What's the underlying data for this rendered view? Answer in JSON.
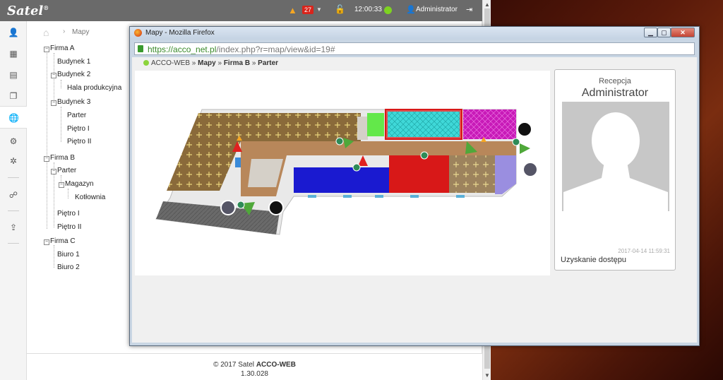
{
  "app": {
    "logo": "Satel",
    "logo_mark": "®"
  },
  "topbar": {
    "alarm_count": "27",
    "time": "12:00:33",
    "user": "Administrator"
  },
  "sidebar_icons": [
    "user-icon",
    "calendar-icon",
    "document-icon",
    "documents-icon",
    "globe-icon",
    "gears-icon",
    "gear-icon",
    "users-icon",
    "upload-icon"
  ],
  "breadcrumb": {
    "label": "Mapy"
  },
  "tree": [
    {
      "label": "Firma A",
      "toggle": "⊟"
    },
    {
      "label": "Budynek 1"
    },
    {
      "label": "Budynek 2",
      "toggle": "⊟"
    },
    {
      "label": "Hala produkcyjna"
    },
    {
      "label": "Budynek 3",
      "toggle": "⊟"
    },
    {
      "label": "Parter"
    },
    {
      "label": "Piętro I"
    },
    {
      "label": "Piętro II"
    },
    {
      "label": "Firma B",
      "toggle": "⊟"
    },
    {
      "label": "Parter",
      "toggle": "⊟"
    },
    {
      "label": "Magazyn",
      "toggle": "⊟"
    },
    {
      "label": "Kotłownia"
    },
    {
      "label": "Piętro I"
    },
    {
      "label": "Piętro II"
    },
    {
      "label": "Firma C",
      "toggle": "⊟"
    },
    {
      "label": "Biuro 1"
    },
    {
      "label": "Biuro 2"
    }
  ],
  "footer": {
    "copyright": "© 2017 Satel",
    "product": "ACCO-WEB",
    "version": "1.30.028"
  },
  "firefox": {
    "title": "Mapy - Mozilla Firefox",
    "url_host": "https://acco_net.pl",
    "url_path": "/index.php?r=map/view&id=19#",
    "breadcrumb": {
      "root": "ACCO-WEB",
      "sep": "»",
      "items": [
        "Mapy",
        "Firma B",
        "Parter"
      ]
    },
    "card": {
      "subtitle": "Recepcja",
      "name": "Administrator",
      "timestamp": "2017-04-14 11:59:31",
      "status": "Uzyskanie dostępu"
    }
  },
  "colors": {
    "topbar": "#6a6a6a",
    "alarm_badge": "#d9241b",
    "status_ok": "#7ed321",
    "zone_blue": "#1a1ad0",
    "zone_red": "#d81818",
    "zone_cyan": "#3fd8d8",
    "zone_magenta": "#c81ab8"
  }
}
